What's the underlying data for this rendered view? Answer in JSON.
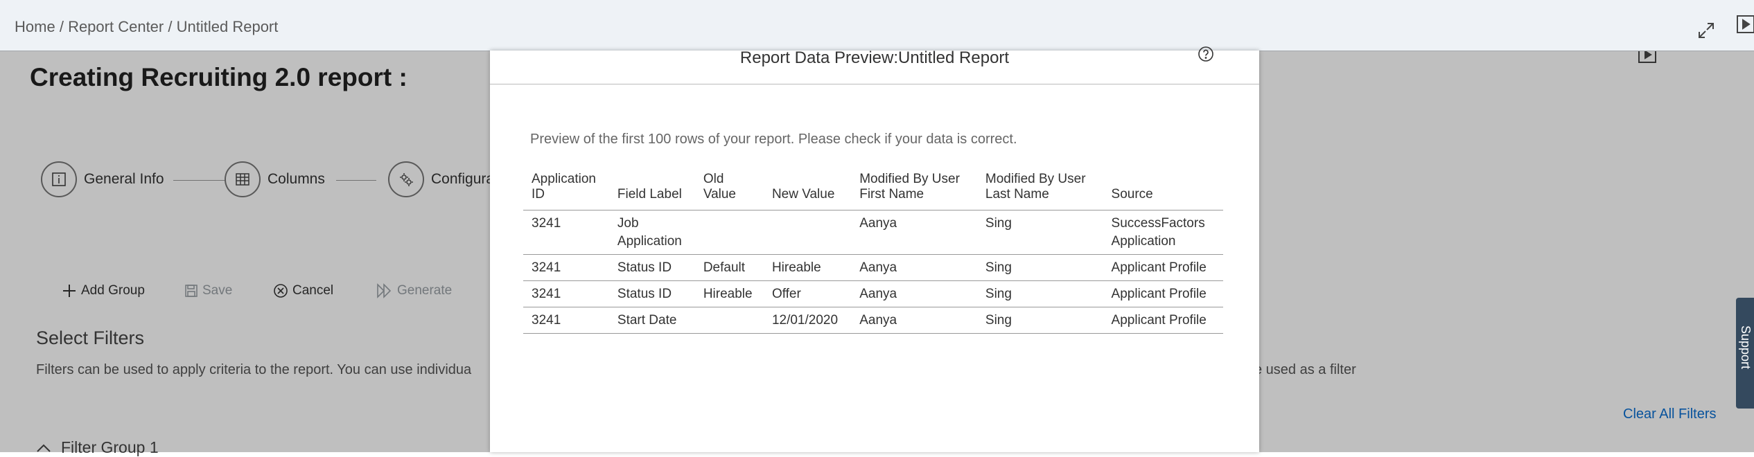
{
  "breadcrumb": {
    "items": [
      "Home",
      "Report Center",
      "Untitled Report"
    ],
    "separator": "/"
  },
  "page": {
    "title": "Creating Recruiting 2.0 report :"
  },
  "steps": [
    {
      "label": "General Info",
      "icon": "info-icon"
    },
    {
      "label": "Columns",
      "icon": "table-icon"
    },
    {
      "label": "Configura",
      "icon": "gear-icon"
    }
  ],
  "toolbar": {
    "add_group": "Add Group",
    "save": "Save",
    "cancel": "Cancel",
    "generate": "Generate"
  },
  "filters": {
    "title": "Select Filters",
    "description": "Filters can be used to apply criteria to the report. You can use individua",
    "description_tail": "e used as a filter",
    "clear_all": "Clear All Filters",
    "group_label": "Filter Group 1"
  },
  "support": {
    "label": "Support"
  },
  "dialog": {
    "title": "Report Data Preview:Untitled Report",
    "description": "Preview of the first 100 rows of your report. Please check if your data is correct.",
    "columns": [
      [
        "Application",
        "ID"
      ],
      [
        "Field Label"
      ],
      [
        "Old",
        "Value"
      ],
      [
        "New Value"
      ],
      [
        "Modified By User",
        "First Name"
      ],
      [
        "Modified By User",
        "Last Name"
      ],
      [
        "Source"
      ]
    ],
    "rows": [
      [
        [
          "3241"
        ],
        [
          "Job",
          "Application"
        ],
        [
          ""
        ],
        [
          ""
        ],
        [
          "Aanya"
        ],
        [
          "Sing"
        ],
        [
          "SuccessFactors",
          "Application"
        ]
      ],
      [
        [
          "3241"
        ],
        [
          "Status ID"
        ],
        [
          "Default"
        ],
        [
          "Hireable"
        ],
        [
          "Aanya"
        ],
        [
          "Sing"
        ],
        [
          "Applicant Profile"
        ]
      ],
      [
        [
          "3241"
        ],
        [
          "Status ID"
        ],
        [
          "Hireable"
        ],
        [
          "Offer"
        ],
        [
          "Aanya"
        ],
        [
          "Sing"
        ],
        [
          "Applicant Profile"
        ]
      ],
      [
        [
          "3241"
        ],
        [
          "Start Date"
        ],
        [
          ""
        ],
        [
          "12/01/2020"
        ],
        [
          "Aanya"
        ],
        [
          "Sing"
        ],
        [
          "Applicant Profile"
        ]
      ]
    ]
  },
  "colors": {
    "accent": "#0a6ed1",
    "topbar": "#eef2f6",
    "support": "#34495e"
  }
}
